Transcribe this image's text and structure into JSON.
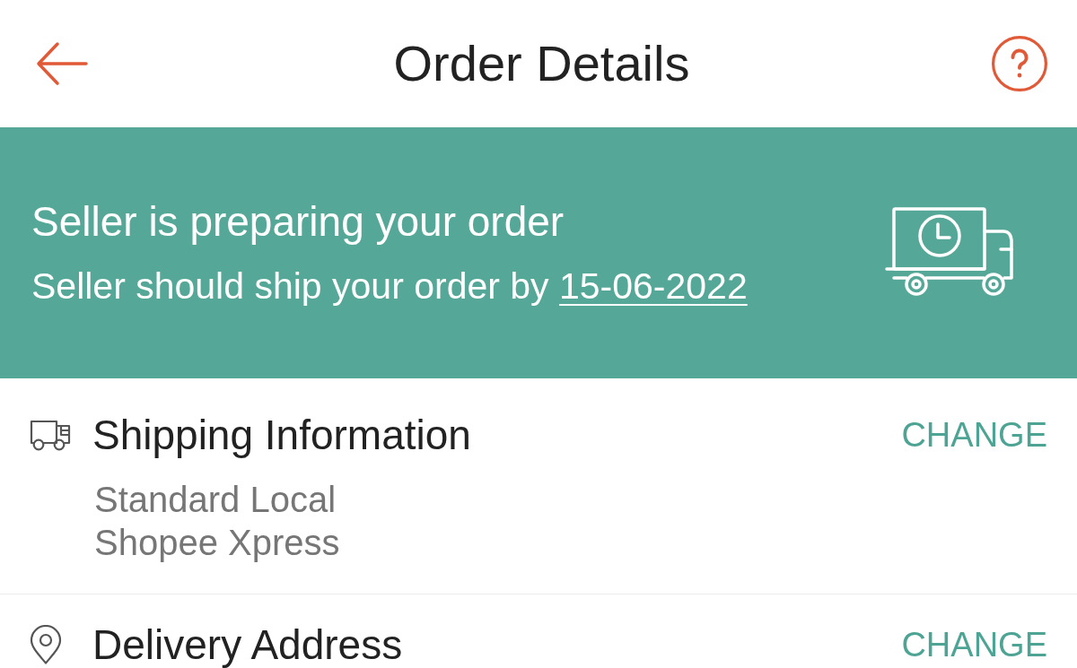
{
  "header": {
    "title": "Order Details"
  },
  "status_banner": {
    "title": "Seller is preparing your order",
    "message": "Seller should ship your order by",
    "date": "15-06-2022"
  },
  "sections": [
    {
      "kind": "shipping",
      "title": "Shipping Information",
      "action": "CHANGE",
      "lines": [
        "Standard Local",
        "Shopee Xpress"
      ]
    },
    {
      "kind": "address",
      "title": "Delivery Address",
      "action": "CHANGE"
    }
  ]
}
